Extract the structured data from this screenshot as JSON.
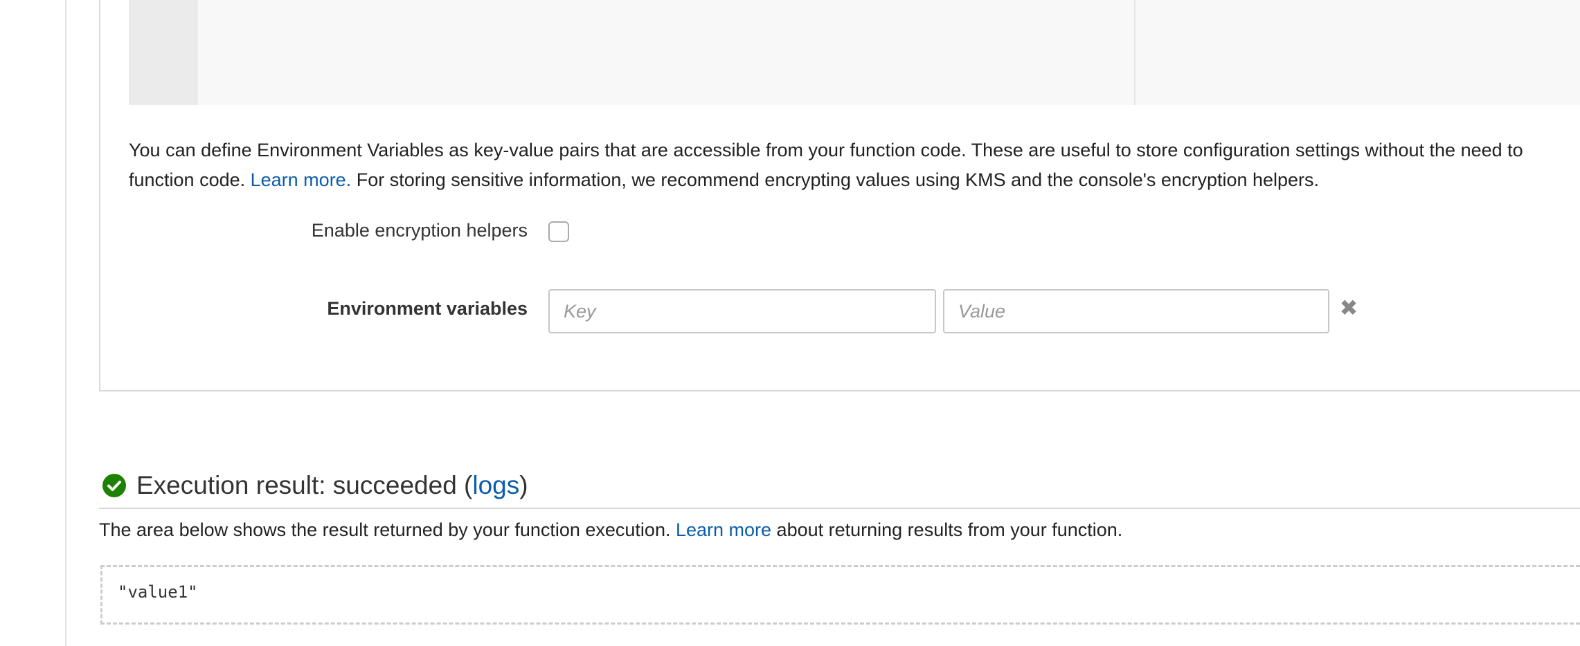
{
  "env": {
    "description_part1": "You can define Environment Variables as key-value pairs that are accessible from your function code. These are useful to store configuration settings without the need to",
    "description_part2": "function code. ",
    "learn_more": "Learn more.",
    "description_part3": " For storing sensitive information, we recommend encrypting values using KMS and the console's encryption helpers.",
    "encryption_label": "Enable encryption helpers",
    "encryption_checked": false,
    "vars_label": "Environment variables",
    "key_placeholder": "Key",
    "value_placeholder": "Value",
    "remove_icon": "close-icon"
  },
  "result": {
    "check_icon": "check-circle-icon",
    "status_color": "#1d8102",
    "title_prefix": "Execution result: succeeded (",
    "logs_link": "logs",
    "title_suffix": ")",
    "desc_prefix": "The area below shows the result returned by your function execution. ",
    "learn_more": "Learn more",
    "desc_suffix": " about returning results from your function.",
    "value": "\"value1\""
  },
  "colors": {
    "link": "#0a5dac"
  }
}
